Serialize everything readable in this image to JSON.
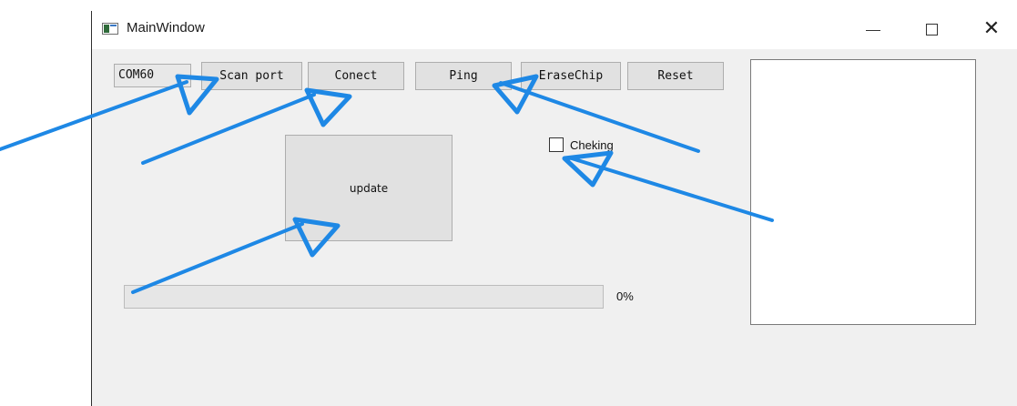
{
  "window": {
    "title": "MainWindow",
    "icon": "app-window-icon",
    "controls": {
      "minimize": "minimize-icon",
      "maximize": "maximize-icon",
      "close": "close-icon",
      "close_glyph": "✕"
    }
  },
  "toolbar": {
    "port_select": {
      "value": "COM60",
      "arrow": "⌄"
    },
    "buttons": {
      "scan": "Scan port",
      "connect": "Conect",
      "ping": "Ping",
      "erase": "EraseChip",
      "reset": "Reset"
    }
  },
  "main": {
    "update_button": "update",
    "checking_label": "Cheking",
    "checking_checked": false
  },
  "progress": {
    "value": 0,
    "label": "0%"
  },
  "annotations": {
    "color": "#1e88e5",
    "icon": "arrow-annotation-icon"
  }
}
